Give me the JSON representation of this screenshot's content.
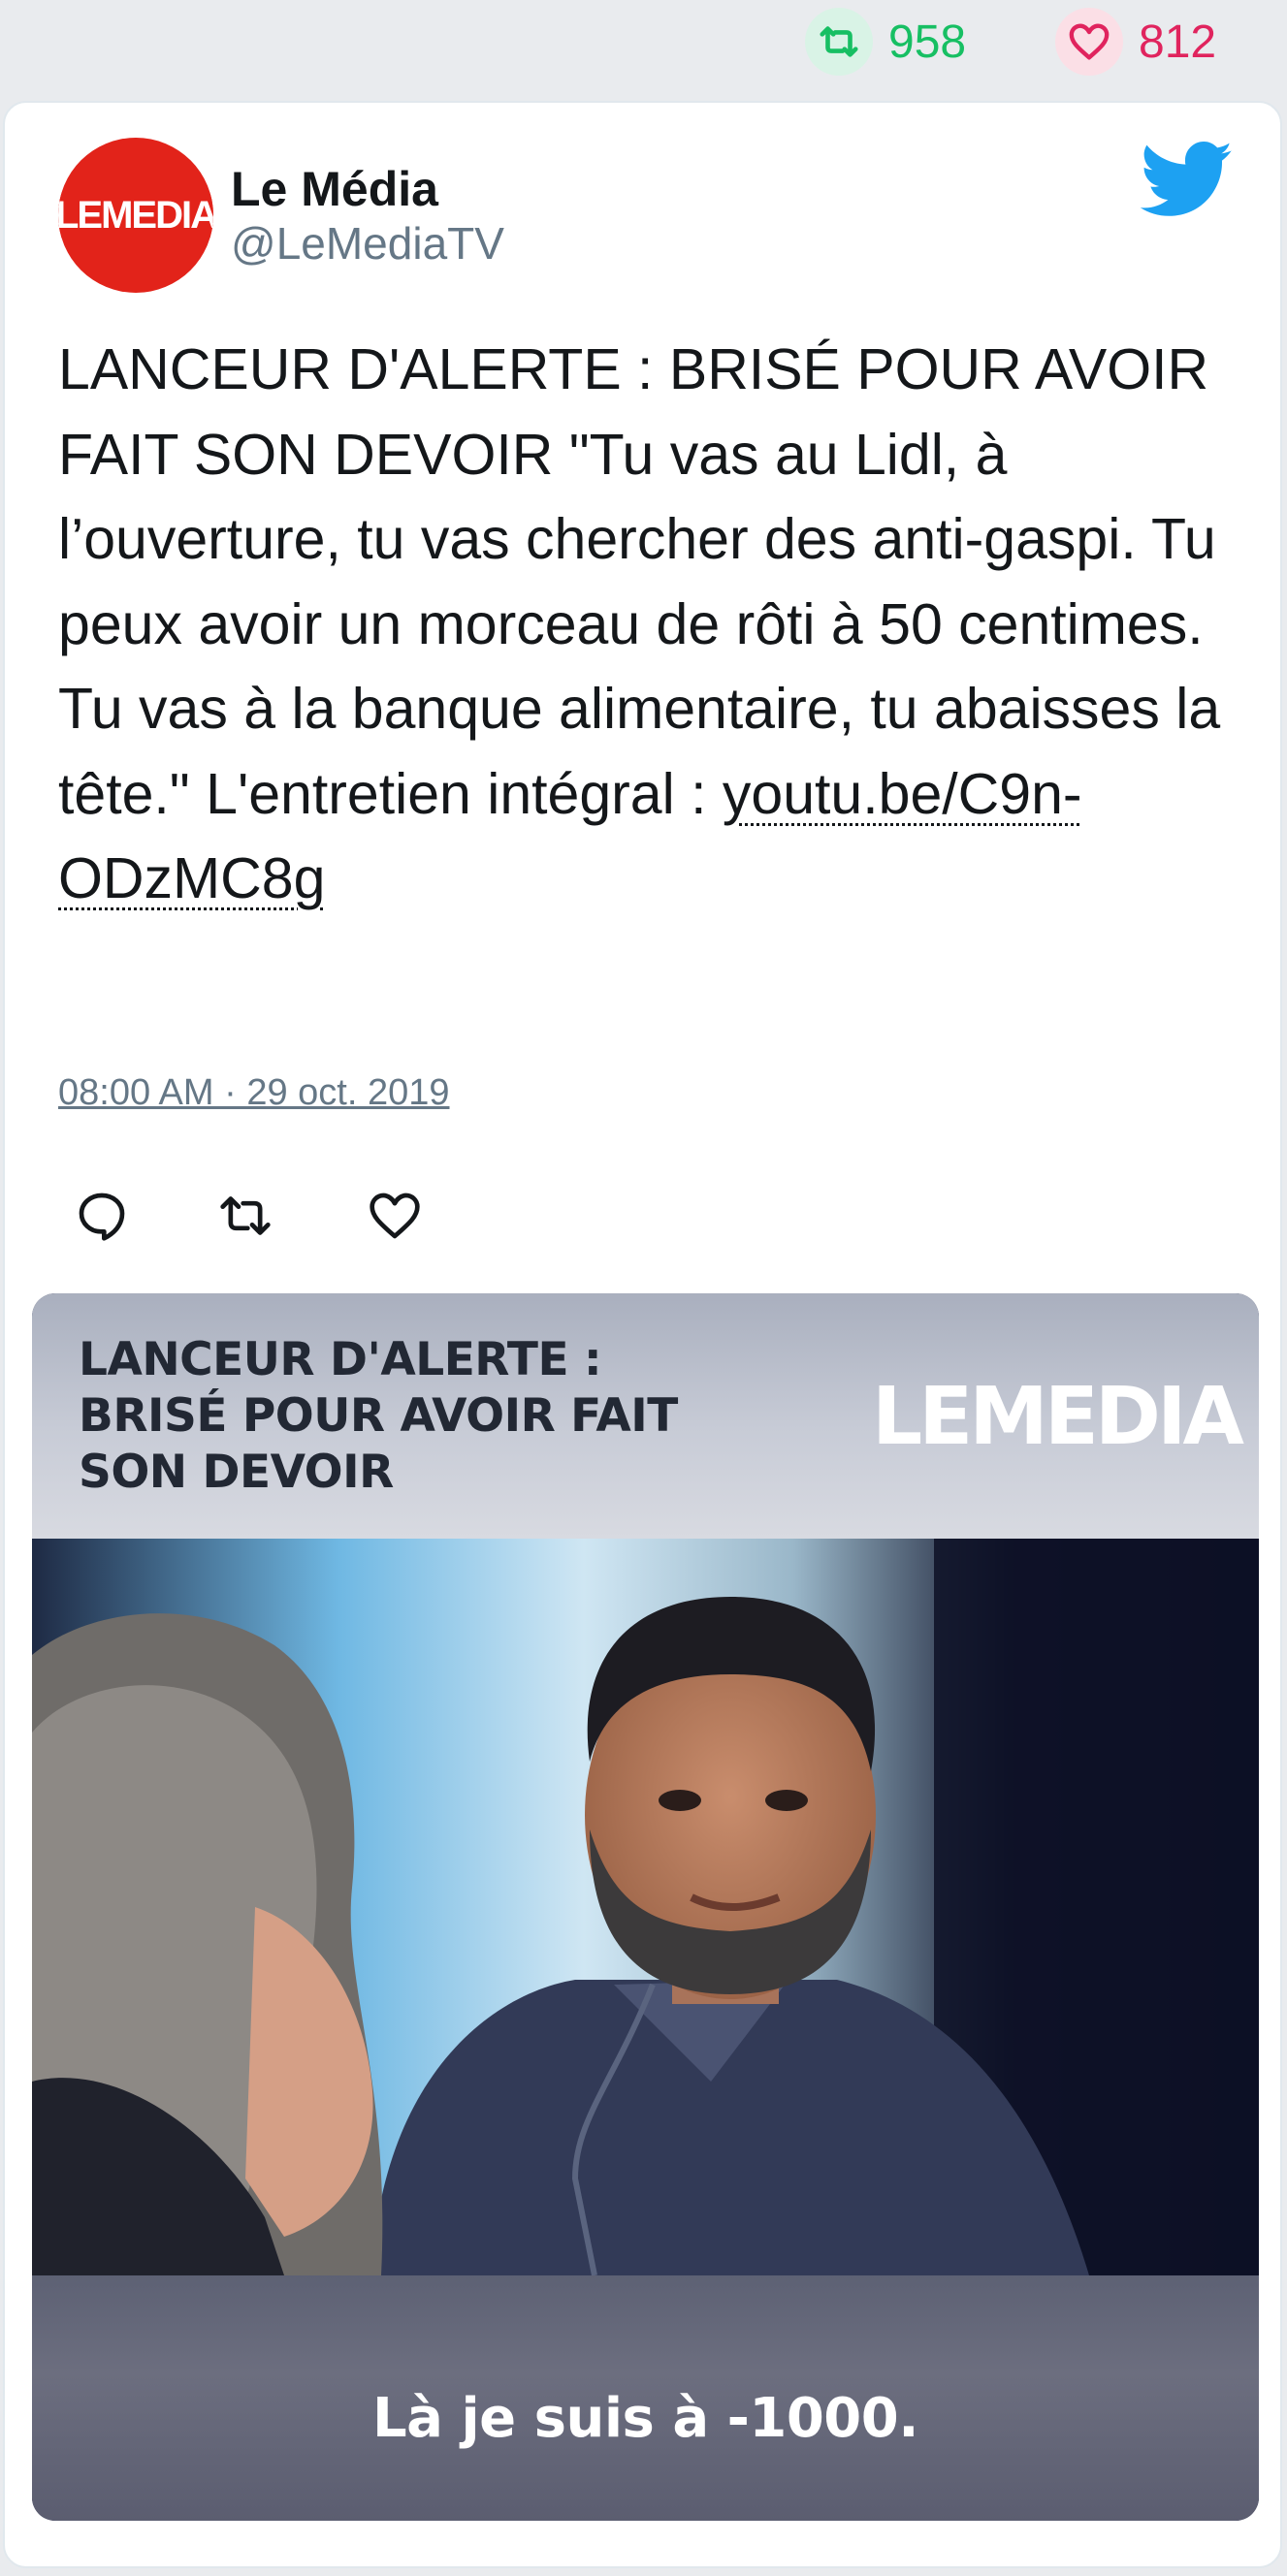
{
  "stats": {
    "retweets": "958",
    "likes": "812"
  },
  "colors": {
    "retweet_green": "#17bf63",
    "like_red": "#e0245e",
    "twitter_blue": "#1da1f2",
    "brand_red": "#e2231a"
  },
  "tweet": {
    "display_name": "Le Média",
    "handle": "@LeMediaTV",
    "avatar_text": "LEMEDIA",
    "text": "LANCEUR D'ALERTE : BRISÉ POUR AVOIR FAIT SON DEVOIR \"Tu vas au Lidl, à l’ouverture, tu vas chercher des anti-gaspi. Tu peux avoir un morceau de rôti à 50 centimes. Tu vas à la banque alimentaire, tu abaisses la tête.\" L'entretien intégral : ",
    "link_text": "youtu.be/C9n-ODzMC8g",
    "timestamp": "08:00 AM · 29 oct. 2019"
  },
  "icons": {
    "retweet": "retweet-icon",
    "like": "heart-icon",
    "brand": "twitter-bird-icon",
    "reply": "reply-icon"
  },
  "media": {
    "title": "LANCEUR D'ALERTE : BRISÉ POUR AVOIR FAIT SON DEVOIR",
    "logo_text": "LEMEDIA",
    "caption": "Là je suis à -1000."
  }
}
